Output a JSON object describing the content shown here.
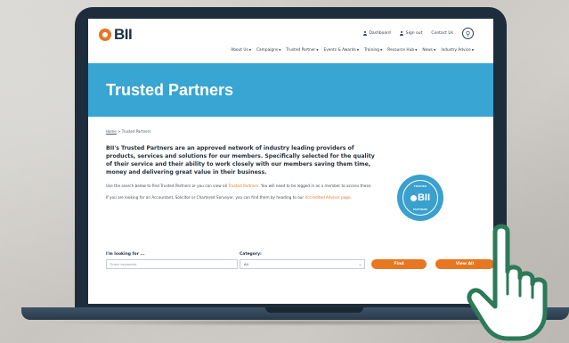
{
  "site": {
    "logo_text": "BII",
    "utility_nav": {
      "dashboard": "Dashboard",
      "sign_out": "Sign out",
      "contact": "Contact Us"
    },
    "main_nav": [
      {
        "label": "About Us"
      },
      {
        "label": "Campaigns"
      },
      {
        "label": "Trusted Partner"
      },
      {
        "label": "Events & Awards"
      },
      {
        "label": "Training"
      },
      {
        "label": "Resource Hub"
      },
      {
        "label": "News"
      },
      {
        "label": "Industry Advice"
      }
    ],
    "hero_title": "Trusted Partners",
    "breadcrumb": {
      "home": "Home",
      "separator": ">",
      "current": "Trusted Partners"
    },
    "intro": "BII's Trusted Partners are an approved network of industry leading providers of products, services and solutions for our members. Specifically selected for the quality of their service and their ability to work closely with our members saving them time, money and delivering great value in their business.",
    "para1": {
      "text_before": "Use the search below to find Trusted Partners or you can view all ",
      "link": "Trusted Partners",
      "text_after": ". You will need to be logged in as a member to access these."
    },
    "para2": {
      "text_before": "If you are looking for an Accountant, Solicitor or Chartered Surveyor, you can find them by heading to our ",
      "link": "Accredited Advisor page",
      "text_after": "."
    },
    "badge": {
      "top": "TRUSTED",
      "center": "BII",
      "bottom": "PARTNERS"
    },
    "search": {
      "looking_label": "I'm looking for ...",
      "keywords_placeholder": "Enter keywords",
      "category_label": "Category:",
      "category_value": "All",
      "find_label": "Find",
      "view_all_label": "View All"
    }
  },
  "colors": {
    "accent": "#e87722",
    "hero": "#39a5d2",
    "navy": "#1e2d3b",
    "hand": "#2c7a5a"
  },
  "icons": [
    "person-icon",
    "search-icon",
    "caret-down-icon",
    "hand-pointer-icon"
  ]
}
